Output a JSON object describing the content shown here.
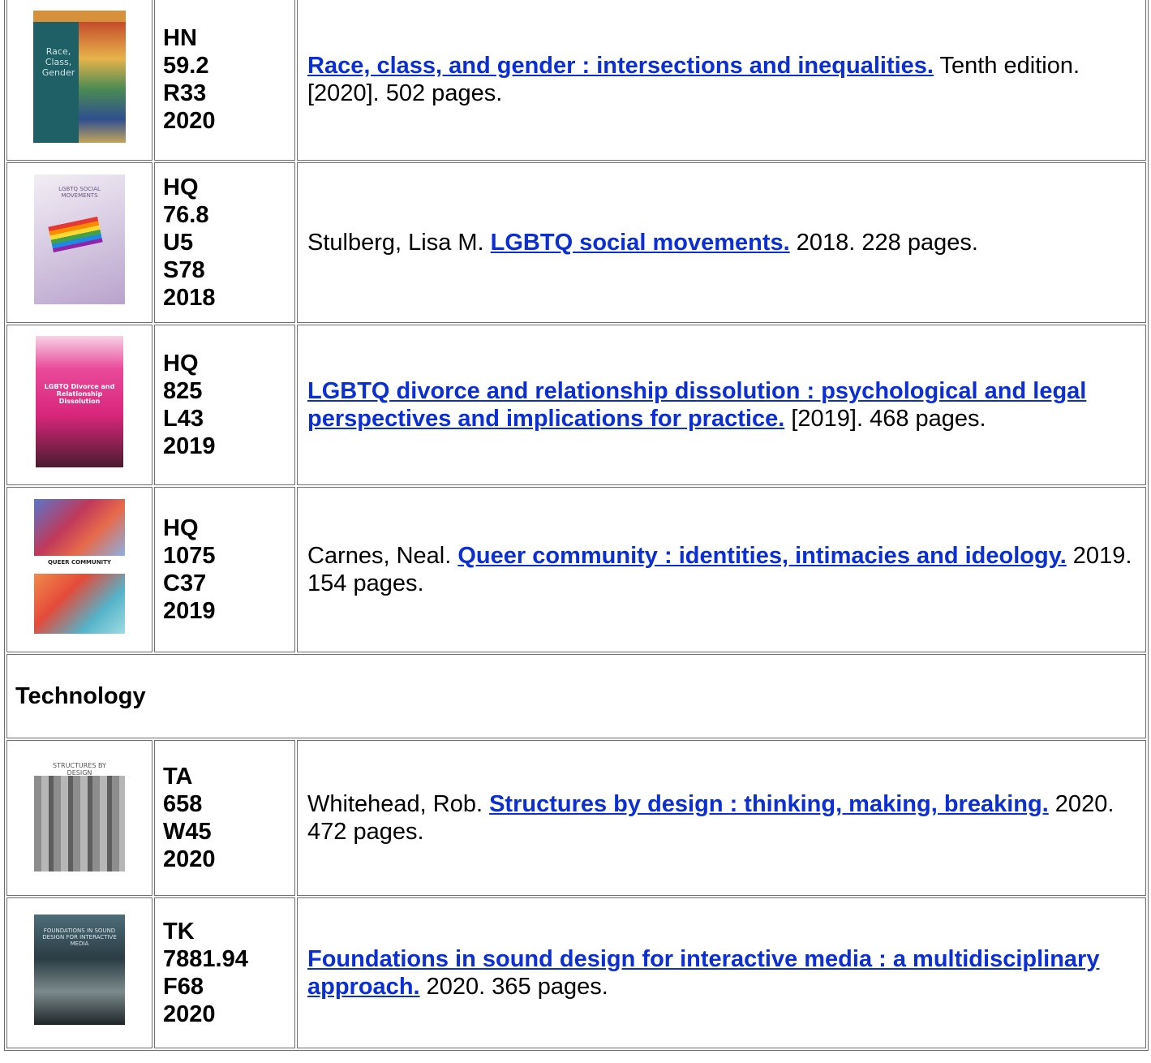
{
  "rows": [
    {
      "cover": {
        "name": "race-class-gender-cover",
        "text": "Race, Class, Gender"
      },
      "call_number": [
        "HN",
        "59.2",
        "R33",
        "2020"
      ],
      "prefix": "",
      "title": "Race, class, and gender : intersections and inequalities.",
      "suffix": " Tenth edition. [2020]. 502 pages."
    },
    {
      "cover": {
        "name": "lgbtq-social-movements-cover",
        "text": "LGBTQ SOCIAL MOVEMENTS"
      },
      "call_number": [
        "HQ",
        "76.8",
        "U5",
        "S78",
        "2018"
      ],
      "prefix": "Stulberg, Lisa M. ",
      "title": "LGBTQ social movements.",
      "suffix": " 2018. 228 pages."
    },
    {
      "cover": {
        "name": "lgbtq-divorce-cover",
        "text": "LGBTQ Divorce and Relationship Dissolution"
      },
      "call_number": [
        "HQ",
        "825",
        "L43",
        "2019"
      ],
      "prefix": "",
      "title": "LGBTQ divorce and relationship dissolution : psychological and legal perspectives and implications for practice.",
      "suffix": " [2019]. 468 pages."
    },
    {
      "cover": {
        "name": "queer-community-cover",
        "text": "QUEER COMMUNITY"
      },
      "call_number": [
        "HQ",
        "1075",
        "C37",
        "2019"
      ],
      "prefix": "Carnes, Neal. ",
      "title": "Queer community : identities, intimacies and ideology.",
      "suffix": " 2019. 154 pages."
    }
  ],
  "section_technology": "Technology",
  "tech_rows": [
    {
      "cover": {
        "name": "structures-by-design-cover",
        "text": "STRUCTURES BY DESIGN"
      },
      "call_number": [
        "TA",
        "658",
        "W45",
        "2020"
      ],
      "prefix": "Whitehead, Rob. ",
      "title": "Structures by design : thinking, making, breaking.",
      "suffix": " 2020. 472 pages."
    },
    {
      "cover": {
        "name": "foundations-sound-design-cover",
        "text": "FOUNDATIONS IN SOUND DESIGN FOR INTERACTIVE MEDIA"
      },
      "call_number": [
        "TK",
        "7881.94",
        "F68",
        "2020"
      ],
      "prefix": "",
      "title": "Foundations in sound design for interactive media : a multidisciplinary approach.",
      "suffix": " 2020. 365 pages."
    }
  ]
}
